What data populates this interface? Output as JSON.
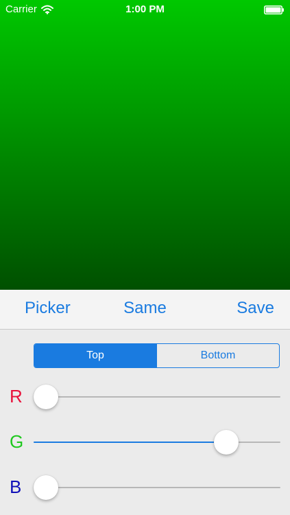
{
  "status_bar": {
    "carrier": "Carrier",
    "time": "1:00 PM",
    "wifi_icon": "wifi-icon",
    "battery_icon": "battery-icon"
  },
  "preview": {
    "top_color": "#00c800",
    "bottom_color": "#005000"
  },
  "toolbar": {
    "picker_label": "Picker",
    "same_label": "Same",
    "save_label": "Save"
  },
  "segmented": {
    "options": [
      "Top",
      "Bottom"
    ],
    "selected": "Top"
  },
  "sliders": {
    "r": {
      "label": "R",
      "value": 0.0,
      "color": "#e8113a"
    },
    "g": {
      "label": "G",
      "value": 0.78,
      "color": "#1ec81e"
    },
    "b": {
      "label": "B",
      "value": 0.0,
      "color": "#1010b8"
    }
  },
  "colors": {
    "accent": "#1a7be0",
    "track": "#b7b7b7"
  }
}
